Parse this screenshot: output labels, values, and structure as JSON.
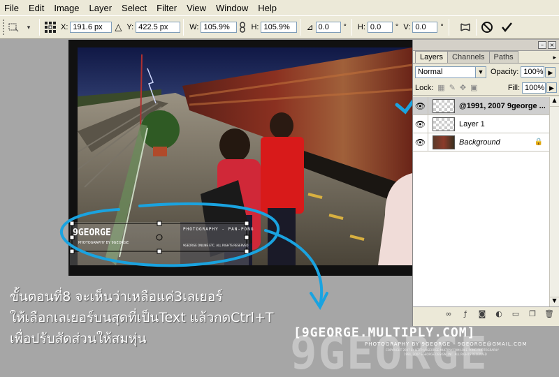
{
  "menu": [
    "File",
    "Edit",
    "Image",
    "Layer",
    "Select",
    "Filter",
    "View",
    "Window",
    "Help"
  ],
  "options": {
    "x_label": "X:",
    "x_value": "191.6 px",
    "y_label": "Y:",
    "y_value": "422.5 px",
    "w_label": "W:",
    "w_value": "105.9%",
    "h_label": "H:",
    "h_value": "105.9%",
    "angle_value": "0.0",
    "hskew_label": "H:",
    "hskew_value": "0.0",
    "vskew_label": "V:",
    "vskew_value": "0.0",
    "degree": "°"
  },
  "panel": {
    "tabs": [
      "Layers",
      "Channels",
      "Paths"
    ],
    "blend_mode": "Normal",
    "opacity_label": "Opacity:",
    "opacity_value": "100%",
    "lock_label": "Lock:",
    "fill_label": "Fill:",
    "fill_value": "100%",
    "layers": [
      {
        "name": "@1991, 2007 9george ..."
      },
      {
        "name": "Layer 1"
      },
      {
        "name": "Background"
      }
    ]
  },
  "overlay_text": {
    "logo_small": "9GEORGE",
    "photo_credit": "PHOTOGRAPHY BY 9GEORGE",
    "phone_text": "PHOTOGRAPHY - PAN-PONG",
    "credit_line": "9GEORGE ONLINE ETC. ALL RIGHTS RESERVED"
  },
  "instructions": {
    "line1": "ขั้นตอนที่8  จะเห็นว่าเหลือแค่3เลเยอร์",
    "line2": "ให้เลือกเลเยอร์บนสุดที่เป็นText  แล้วกดCtrl+T",
    "line3": "เพื่อปรับสัดส่วนให้สมหุ่น"
  },
  "watermark": {
    "site": "[9GEORGE.MULTIPLY.COM]",
    "small": "PHOTOGRAPHY BY 9GEORGE - 9GEORGE@GMAIL.COM",
    "tiny1": "COPYRIGHT 2007 BY HTTP://9GEORGE.MULTIPLY.COM  LOKE PONG PHOTOGRAPHY",
    "tiny2": "1991, 2007 9GEORGE DESIGN, INC. ALL RIGHTS RESERVED",
    "big": "9GEORGE"
  },
  "colors": {
    "annotation": "#1aa3e0",
    "train": "#7a2a1e"
  }
}
